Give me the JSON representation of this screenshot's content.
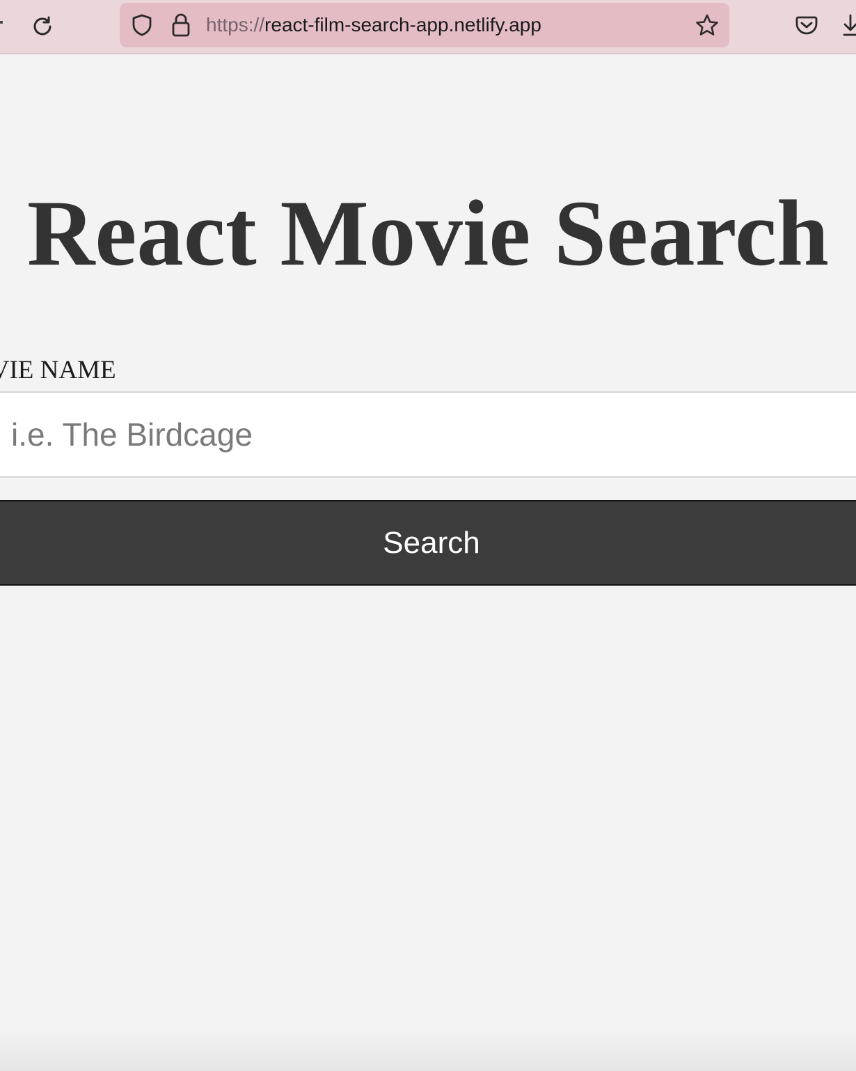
{
  "browser": {
    "url_scheme": "https://",
    "url_host": "react-film-search-app.netlify.app",
    "toolbar_color": "#ebd6da",
    "urlbar_color": "#e4bcc4",
    "icons": [
      "reload-icon",
      "shield-icon",
      "lock-icon",
      "star-icon",
      "pocket-icon",
      "download-icon"
    ]
  },
  "page": {
    "title": "React Movie Search",
    "label": "OVIE NAME",
    "search_placeholder": "i.e. The Birdcage",
    "search_value": "",
    "search_button_label": "Search",
    "background_color": "#f3f3f3",
    "button_color": "#3c3c3c"
  }
}
